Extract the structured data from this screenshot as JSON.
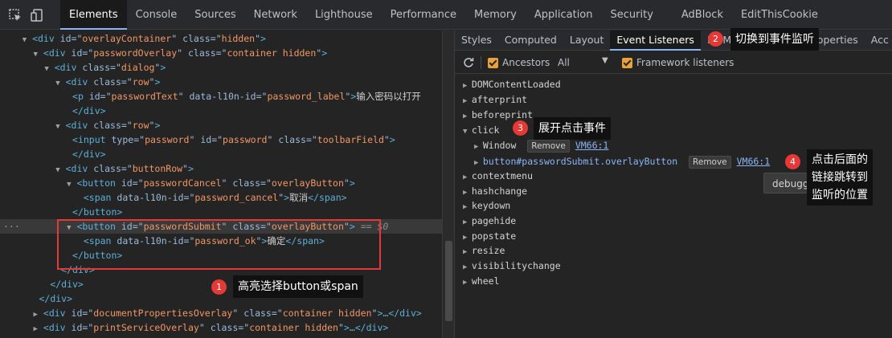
{
  "top_tabs": [
    "Elements",
    "Console",
    "Sources",
    "Network",
    "Lighthouse",
    "Performance",
    "Memory",
    "Application",
    "Security",
    "AdBlock",
    "EditThisCookie"
  ],
  "right_tabs": [
    "Styles",
    "Computed",
    "Layout",
    "Event Listeners",
    "DOM Breakpoints",
    "Properties",
    "Acc"
  ],
  "toolbar": {
    "ancestors": "Ancestors",
    "scope": "All",
    "framework": "Framework listeners"
  },
  "dom": {
    "l0": {
      "indent": "    ",
      "tri": "▼",
      "open": "<div",
      "attrs": [
        [
          "id",
          "overlayContainer"
        ],
        [
          "class",
          "hidden"
        ]
      ],
      "close": ">"
    },
    "l1": {
      "indent": "      ",
      "tri": "▼",
      "open": "<div",
      "attrs": [
        [
          "id",
          "passwordOverlay"
        ],
        [
          "class",
          "container hidden"
        ]
      ],
      "close": ">"
    },
    "l2": {
      "indent": "        ",
      "tri": "▼",
      "open": "<div",
      "attrs": [
        [
          "class",
          "dialog"
        ]
      ],
      "close": ">"
    },
    "l3": {
      "indent": "          ",
      "tri": "▼",
      "open": "<div",
      "attrs": [
        [
          "class",
          "row"
        ]
      ],
      "close": ">"
    },
    "l4": {
      "indent": "             ",
      "tri": "",
      "open": "<p",
      "attrs": [
        [
          "id",
          "passwordText"
        ],
        [
          "data-l10n-id",
          "password_label"
        ]
      ],
      "close": ">",
      "text": "输入密码以打开",
      "end": ""
    },
    "l5": {
      "indent": "             ",
      "tri": "",
      "open": "</div>",
      "attrs": [],
      "close": ""
    },
    "l6": {
      "indent": "          ",
      "tri": "▼",
      "open": "<div",
      "attrs": [
        [
          "class",
          "row"
        ]
      ],
      "close": ">"
    },
    "l7": {
      "indent": "             ",
      "tri": "",
      "open": "<input",
      "attrs": [
        [
          "type",
          "password"
        ],
        [
          "id",
          "password"
        ],
        [
          "class",
          "toolbarField"
        ]
      ],
      "close": ">"
    },
    "l8": {
      "indent": "             ",
      "tri": "",
      "open": "</div>",
      "attrs": [],
      "close": ""
    },
    "l9": {
      "indent": "          ",
      "tri": "▼",
      "open": "<div",
      "attrs": [
        [
          "class",
          "buttonRow"
        ]
      ],
      "close": ">"
    },
    "l10": {
      "indent": "            ",
      "tri": "▼",
      "open": "<button",
      "attrs": [
        [
          "id",
          "passwordCancel"
        ],
        [
          "class",
          "overlayButton"
        ]
      ],
      "close": ">"
    },
    "l11": {
      "indent": "               ",
      "tri": "",
      "open": "<span",
      "attrs": [
        [
          "data-l10n-id",
          "password_cancel"
        ]
      ],
      "close": ">",
      "text": "取消",
      "end": "</span>"
    },
    "l12": {
      "indent": "             ",
      "tri": "",
      "open": "</button>",
      "attrs": [],
      "close": ""
    },
    "l13": {
      "indent": "            ",
      "tri": "▼",
      "open": "<button",
      "attrs": [
        [
          "id",
          "passwordSubmit"
        ],
        [
          "class",
          "overlayButton"
        ]
      ],
      "close": ">",
      "marker": " == $0"
    },
    "l14": {
      "indent": "               ",
      "tri": "",
      "open": "<span",
      "attrs": [
        [
          "data-l10n-id",
          "password_ok"
        ]
      ],
      "close": ">",
      "text": "确定",
      "end": "</span>"
    },
    "l15": {
      "indent": "             ",
      "tri": "",
      "open": "</button>",
      "attrs": [],
      "close": ""
    },
    "l16": {
      "indent": "           ",
      "tri": "",
      "open": "</div>",
      "attrs": [],
      "close": ""
    },
    "l17": {
      "indent": "         ",
      "tri": "",
      "open": "</div>",
      "attrs": [],
      "close": ""
    },
    "l18": {
      "indent": "       ",
      "tri": "",
      "open": "</div>",
      "attrs": [],
      "close": ""
    },
    "l19": {
      "indent": "      ",
      "tri": "▶",
      "open": "<div",
      "attrs": [
        [
          "id",
          "documentPropertiesOverlay"
        ],
        [
          "class",
          "container hidden"
        ]
      ],
      "close": ">…</div>"
    },
    "l20": {
      "indent": "      ",
      "tri": "▶",
      "open": "<div",
      "attrs": [
        [
          "id",
          "printServiceOverlay"
        ],
        [
          "class",
          "container hidden"
        ]
      ],
      "close": ">…</div>"
    }
  },
  "events": {
    "e0": "DOMContentLoaded",
    "e1": "afterprint",
    "e2": "beforeprint",
    "e3": "click",
    "e4": "contextmenu",
    "e5": "hashchange",
    "e6": "keydown",
    "e7": "pagehide",
    "e8": "popstate",
    "e9": "resize",
    "e10": "visibilitychange",
    "e11": "wheel"
  },
  "click_listeners": {
    "window": {
      "label": "Window",
      "remove": "Remove",
      "link": "VM66:1"
    },
    "button": {
      "label": "button#passwordSubmit.overlayButton",
      "remove": "Remove",
      "link": "VM66:1"
    }
  },
  "debug_button": "debugger",
  "annotations": {
    "a1": {
      "num": "1",
      "text": "高亮选择button或span"
    },
    "a2": {
      "num": "2",
      "text": "切换到事件监听"
    },
    "a3": {
      "num": "3",
      "text": "展开点击事件"
    },
    "a4": {
      "num": "4",
      "line1": "点击后面的",
      "line2": "链接跳转到",
      "line3": "监听的位置"
    }
  }
}
